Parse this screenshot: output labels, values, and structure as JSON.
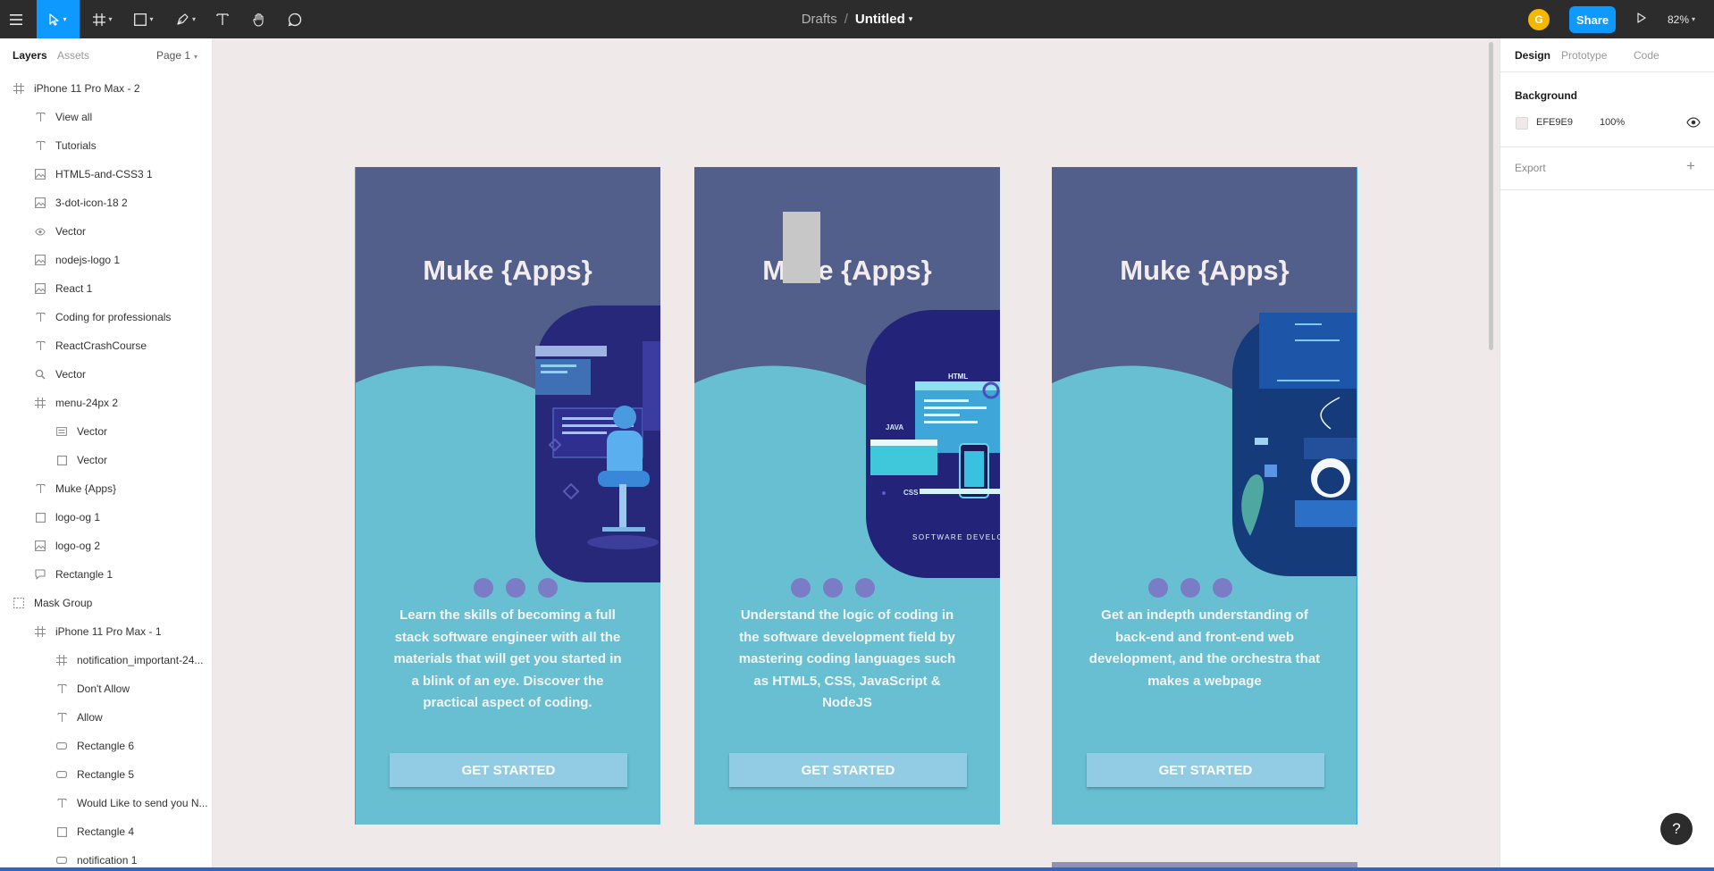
{
  "toolbar": {
    "breadcrumb_drafts": "Drafts",
    "breadcrumb_sep": "/",
    "file_name": "Untitled",
    "avatar_initial": "G",
    "share_label": "Share",
    "zoom": "82%"
  },
  "left_panel": {
    "tab_layers": "Layers",
    "tab_assets": "Assets",
    "page_label": "Page 1",
    "layers": [
      {
        "label": "iPhone 11 Pro Max - 2",
        "icon": "frame-icon",
        "indent": 0
      },
      {
        "label": "View all",
        "icon": "text-icon",
        "indent": 1
      },
      {
        "label": "Tutorials",
        "icon": "text-icon",
        "indent": 1
      },
      {
        "label": "HTML5-and-CSS3 1",
        "icon": "image-icon",
        "indent": 1
      },
      {
        "label": "3-dot-icon-18 2",
        "icon": "image-icon",
        "indent": 1
      },
      {
        "label": "Vector",
        "icon": "eye-icon",
        "indent": 1
      },
      {
        "label": "nodejs-logo 1",
        "icon": "image-icon",
        "indent": 1
      },
      {
        "label": "React 1",
        "icon": "image-icon",
        "indent": 1
      },
      {
        "label": "Coding for professionals",
        "icon": "text-icon",
        "indent": 1
      },
      {
        "label": "ReactCrashCourse",
        "icon": "text-icon",
        "indent": 1
      },
      {
        "label": "Vector",
        "icon": "search-icon",
        "indent": 1
      },
      {
        "label": "menu-24px 2",
        "icon": "frame-icon",
        "indent": 1
      },
      {
        "label": "Vector",
        "icon": "lines-icon",
        "indent": 2
      },
      {
        "label": "Vector",
        "icon": "square-icon",
        "indent": 2
      },
      {
        "label": "Muke {Apps}",
        "icon": "text-icon",
        "indent": 1
      },
      {
        "label": "logo-og 1",
        "icon": "square-icon",
        "indent": 1
      },
      {
        "label": "logo-og 2",
        "icon": "image-icon",
        "indent": 1
      },
      {
        "label": "Rectangle 1",
        "icon": "bubble-icon",
        "indent": 1
      },
      {
        "label": "Mask Group",
        "icon": "mask-icon",
        "indent": 0
      },
      {
        "label": "iPhone 11 Pro Max - 1",
        "icon": "frame-icon",
        "indent": 1
      },
      {
        "label": "notification_important-24...",
        "icon": "frame-icon",
        "indent": 2
      },
      {
        "label": "Don't Allow",
        "icon": "text-icon",
        "indent": 2
      },
      {
        "label": "Allow",
        "icon": "text-icon",
        "indent": 2
      },
      {
        "label": "Rectangle 6",
        "icon": "rect-icon",
        "indent": 2
      },
      {
        "label": "Rectangle 5",
        "icon": "rect-icon",
        "indent": 2
      },
      {
        "label": "Would Like to send you N...",
        "icon": "text-icon",
        "indent": 2
      },
      {
        "label": "Rectangle 4",
        "icon": "square-icon",
        "indent": 2
      },
      {
        "label": "notification 1",
        "icon": "rect-icon",
        "indent": 2
      }
    ]
  },
  "right_panel": {
    "tab_design": "Design",
    "tab_prototype": "Prototype",
    "tab_code": "Code",
    "background_title": "Background",
    "background_hex": "EFE9E9",
    "background_opacity": "100%",
    "export_label": "Export"
  },
  "frames": [
    {
      "title": "Muke {Apps}",
      "description": "Learn the skills of becoming a full stack software engineer with all the materials that will get you started in a blink of an eye. Discover the practical aspect of coding.",
      "button": "GET STARTED"
    },
    {
      "title": "Muke {Apps}",
      "description": "Understand the logic of coding in the software development field by mastering coding languages such as HTML5, CSS, JavaScript & NodeJS",
      "button": "GET STARTED",
      "illus_labels": {
        "html": "HTML",
        "java": "JAVA",
        "css": "CSS",
        "caption": "SOFTWARE DEVELOP"
      }
    },
    {
      "title": "Muke {Apps}",
      "description": "Get an indepth understanding of back-end and front-end web development, and the orchestra that makes a webpage",
      "button": "GET STARTED"
    }
  ],
  "help_label": "?",
  "colors": {
    "toolbar_bg": "#2c2c2c",
    "accent": "#0d99ff",
    "frame_top": "#515f8a",
    "frame_bottom": "#67bfd1",
    "button_bg": "#92cbe4",
    "dot": "#7b7cc6",
    "canvas_bg": "#efe9e9"
  }
}
